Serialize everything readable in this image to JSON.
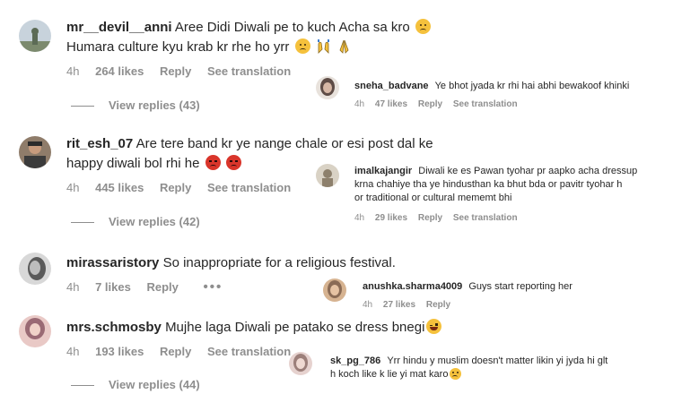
{
  "comments": [
    {
      "username": "mr__devil__anni",
      "text_line1": "Aree Didi Diwali pe to kuch Acha sa kro",
      "text_line2": "Humara culture kyu krab kr rhe ho yrr",
      "time": "4h",
      "likes": "264 likes",
      "reply_label": "Reply",
      "translation_label": "See translation",
      "view_replies": "View replies (43)",
      "emojis_line1": [
        "sad-face-emoji"
      ],
      "emojis_line2": [
        "sad-face-emoji",
        "raised-hands-emoji",
        "folded-hands-emoji"
      ],
      "avatar_colors": [
        "#c8d3dc",
        "#5c6b56"
      ]
    },
    {
      "username": "rit_esh_07",
      "text_line1": "Are tere band kr ye nange chale or esi post dal ke",
      "text_line2": "happy diwali bol rhi he",
      "time": "4h",
      "likes": "445 likes",
      "reply_label": "Reply",
      "translation_label": "See translation",
      "view_replies": "View replies (42)",
      "emojis_line2": [
        "angry-face-emoji",
        "angry-face-emoji"
      ],
      "avatar_colors": [
        "#3b3b3b",
        "#8f7c6a"
      ]
    },
    {
      "username": "mirassaristory",
      "text_line1": "So inappropriate for a religious festival.",
      "time": "4h",
      "likes": "7 likes",
      "reply_label": "Reply",
      "more_label": "•••",
      "avatar_colors": [
        "#d8d8d8",
        "#5a5a5a"
      ]
    },
    {
      "username": "mrs.schmosby",
      "text_line1": "Mujhe laga Diwali pe patako se dress bnegi",
      "time": "4h",
      "likes": "193 likes",
      "reply_label": "Reply",
      "translation_label": "See translation",
      "view_replies": "View replies (44)",
      "emojis_line1": [
        "laughing-face-emoji"
      ],
      "avatar_colors": [
        "#9a6a74",
        "#e9c9c6"
      ]
    }
  ],
  "replies": [
    {
      "username": "sneha_badvane",
      "text_line1": "Ye bhot jyada kr rhi hai abhi bewakoof khinki",
      "time": "4h",
      "likes": "47 likes",
      "reply_label": "Reply",
      "translation_label": "See translation",
      "avatar_colors": [
        "#b7a89e",
        "#5e4c46"
      ]
    },
    {
      "username": "imalkajangir",
      "text_line1": "Diwali ke es Pawan tyohar pr aapko acha dressup",
      "text_line2": "krna chahiye tha ye hindusthan ka bhut bda or pavitr tyohar h",
      "text_line3": "or traditional or cultural mememt bhi",
      "time": "4h",
      "likes": "29 likes",
      "reply_label": "Reply",
      "translation_label": "See translation",
      "avatar_colors": [
        "#d9d2c5",
        "#8d806c"
      ]
    },
    {
      "username": "anushka.sharma4009",
      "text_line1": "Guys start reporting her",
      "time": "4h",
      "likes": "27 likes",
      "reply_label": "Reply",
      "avatar_colors": [
        "#8a6b55",
        "#d6b391"
      ]
    },
    {
      "username": "sk_pg_786",
      "text_line1": "Yrr hindu y muslim doesn't matter likin yi jyda hi glt",
      "text_line2": "h koch like k lie yi mat karo",
      "emojis_line2": [
        "sad-face-emoji"
      ],
      "avatar_colors": [
        "#e6d2cf",
        "#9c7f7a"
      ]
    }
  ]
}
